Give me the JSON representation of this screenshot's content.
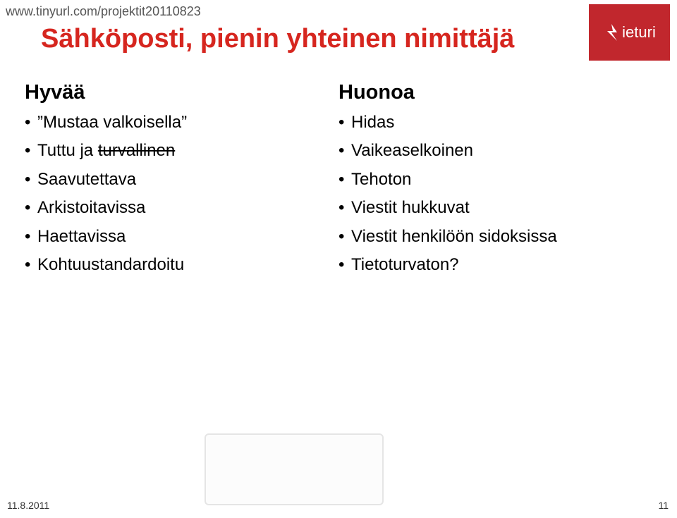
{
  "header": {
    "url": "www.tinyurl.com/projektit20110823",
    "title": "Sähköposti, pienin yhteinen nimittäjä",
    "logo_text": "ieturi"
  },
  "left": {
    "heading": "Hyvää",
    "items": [
      {
        "text": "”Mustaa valkoisella”"
      },
      {
        "prefix": "Tuttu ja ",
        "strike": "turvallinen"
      },
      {
        "text": "Saavutettava"
      },
      {
        "text": "Arkistoitavissa"
      },
      {
        "text": "Haettavissa"
      },
      {
        "text": "Kohtuustandardoitu"
      }
    ]
  },
  "right": {
    "heading": "Huonoa",
    "items": [
      {
        "text": "Hidas"
      },
      {
        "text": "Vaikeaselkoinen"
      },
      {
        "text": "Tehoton"
      },
      {
        "text": "Viestit hukkuvat"
      },
      {
        "text": "Viestit henkilöön sidoksissa"
      },
      {
        "text": "Tietoturvaton?"
      }
    ]
  },
  "footer": {
    "date": "11.8.2011",
    "page": "11"
  }
}
